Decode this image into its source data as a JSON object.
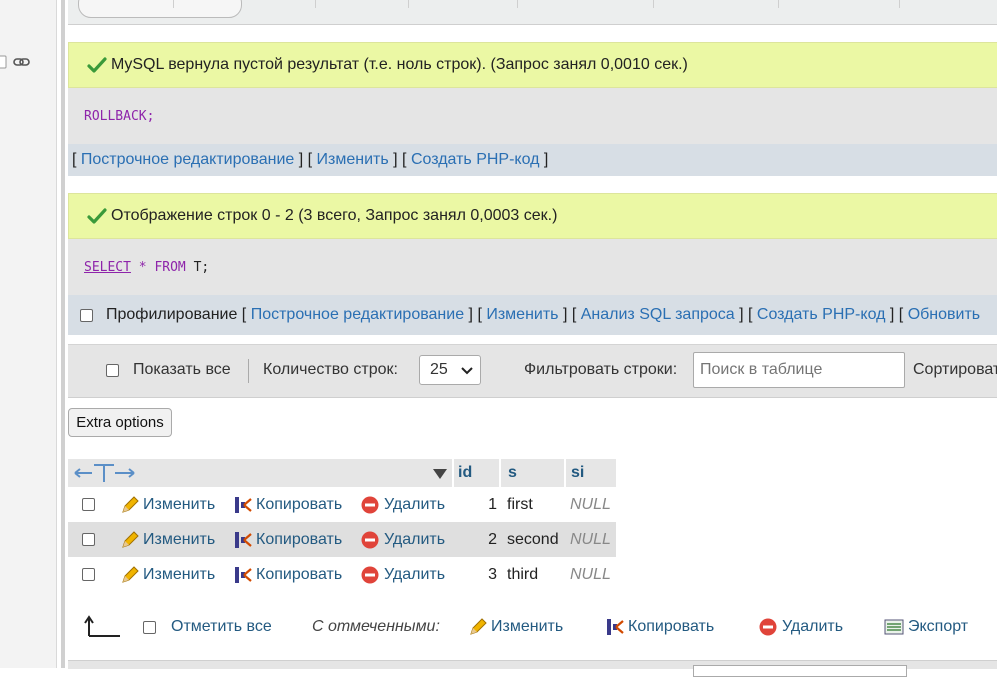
{
  "query1": {
    "message": "MySQL вернула пустой результат (т.е. ноль строк). (Запрос занял 0,0010 сек.)",
    "sql": "ROLLBACK;",
    "links": [
      "Построчное редактирование",
      "Изменить",
      "Создать PHP-код"
    ]
  },
  "query2": {
    "message": "Отображение строк 0 - 2 (3 всего, Запрос занял 0,0003 сек.)",
    "sql_select": "SELECT",
    "sql_star": "*",
    "sql_from": "FROM",
    "sql_table": "T;",
    "profiling_label": "Профилирование",
    "links": [
      "Построчное редактирование",
      "Изменить",
      "Анализ SQL запроса",
      "Создать PHP-код",
      "Обновить"
    ]
  },
  "navbar": {
    "show_all": "Показать все",
    "rows_count_label": "Количество строк:",
    "rows_count_value": "25",
    "filter_label": "Фильтровать строки:",
    "filter_placeholder": "Поиск в таблице",
    "sort_label": "Сортировать"
  },
  "extra_options": "Extra options",
  "table": {
    "columns": [
      "id",
      "s",
      "si"
    ],
    "actions": {
      "edit": "Изменить",
      "copy": "Копировать",
      "delete": "Удалить"
    },
    "rows": [
      {
        "id": "1",
        "s": "first",
        "si": "NULL"
      },
      {
        "id": "2",
        "s": "second",
        "si": "NULL"
      },
      {
        "id": "3",
        "s": "third",
        "si": "NULL"
      }
    ]
  },
  "bottom": {
    "check_all": "Отметить все",
    "with_selected": "С отмеченными:",
    "edit": "Изменить",
    "copy": "Копировать",
    "delete": "Удалить",
    "export": "Экспорт"
  },
  "colors": {
    "success_bg": "#ebf8a4",
    "link": "#2a6fb3",
    "header_text": "#235a81",
    "sql_keyword": "#8e24aa"
  }
}
